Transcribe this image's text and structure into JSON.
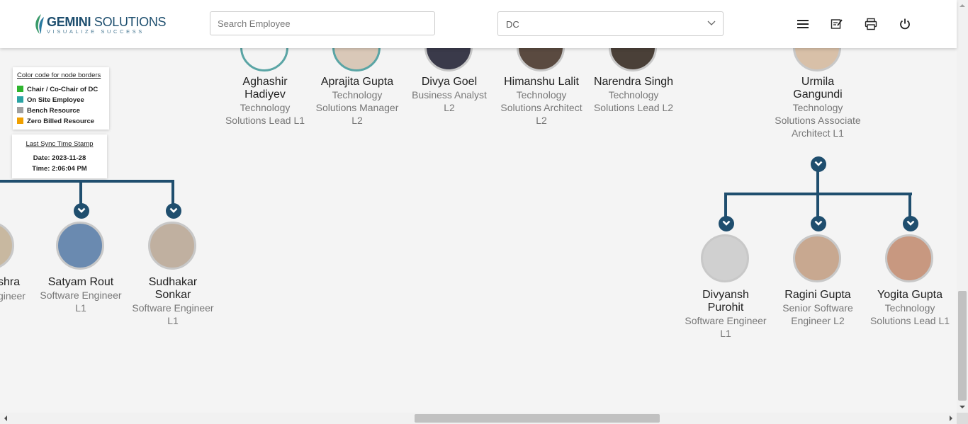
{
  "header": {
    "logo_main": "GEMINI SOLUTIONS",
    "logo_sub": "VISUALIZE SUCCESS",
    "search_placeholder": "Search Employee",
    "select_value": "DC",
    "icons": [
      "menu-icon",
      "edit-note-icon",
      "print-icon",
      "power-icon"
    ]
  },
  "legend": {
    "title": "Color code for node borders",
    "items": [
      {
        "label": "Chair / Co-Chair of DC",
        "color": "#2fb52f"
      },
      {
        "label": "On Site Employee",
        "color": "#2aa3a3"
      },
      {
        "label": "Bench Resource",
        "color": "#a0a0a0"
      },
      {
        "label": "Zero Billed Resource",
        "color": "#f0a000"
      }
    ]
  },
  "sync": {
    "title": "Last Sync Time Stamp",
    "date": "Date: 2023-11-28",
    "time": "Time: 2:06:04 PM"
  },
  "colors": {
    "accent": "#1f4e6e",
    "onsite": "#5aa5a5",
    "default_border": "#c8c8c8"
  },
  "top_nodes": [
    {
      "name": "Aghashir Hadiyev",
      "title": "Technology Solutions Lead L1"
    },
    {
      "name": "Aprajita Gupta",
      "title": "Technology Solutions Manager L2"
    },
    {
      "name": "Divya Goel",
      "title": "Business Analyst L2"
    },
    {
      "name": "Himanshu Lalit",
      "title": "Technology Solutions Architect L2"
    },
    {
      "name": "Narendra Singh",
      "title": "Technology Solutions Lead L2"
    },
    {
      "name": "Urmila Gangundi",
      "title": "Technology Solutions Associate Architect L1"
    }
  ],
  "left_children": [
    {
      "name": "shra",
      "title": "gineer"
    },
    {
      "name": "Satyam Rout",
      "title": "Software Engineer L1"
    },
    {
      "name": "Sudhakar Sonkar",
      "title": "Software Engineer L1"
    }
  ],
  "right_children": [
    {
      "name": "Divyansh Purohit",
      "title": "Software Engineer L1"
    },
    {
      "name": "Ragini Gupta",
      "title": "Senior Software Engineer L2"
    },
    {
      "name": "Yogita Gupta",
      "title": "Technology Solutions Lead L1"
    }
  ]
}
